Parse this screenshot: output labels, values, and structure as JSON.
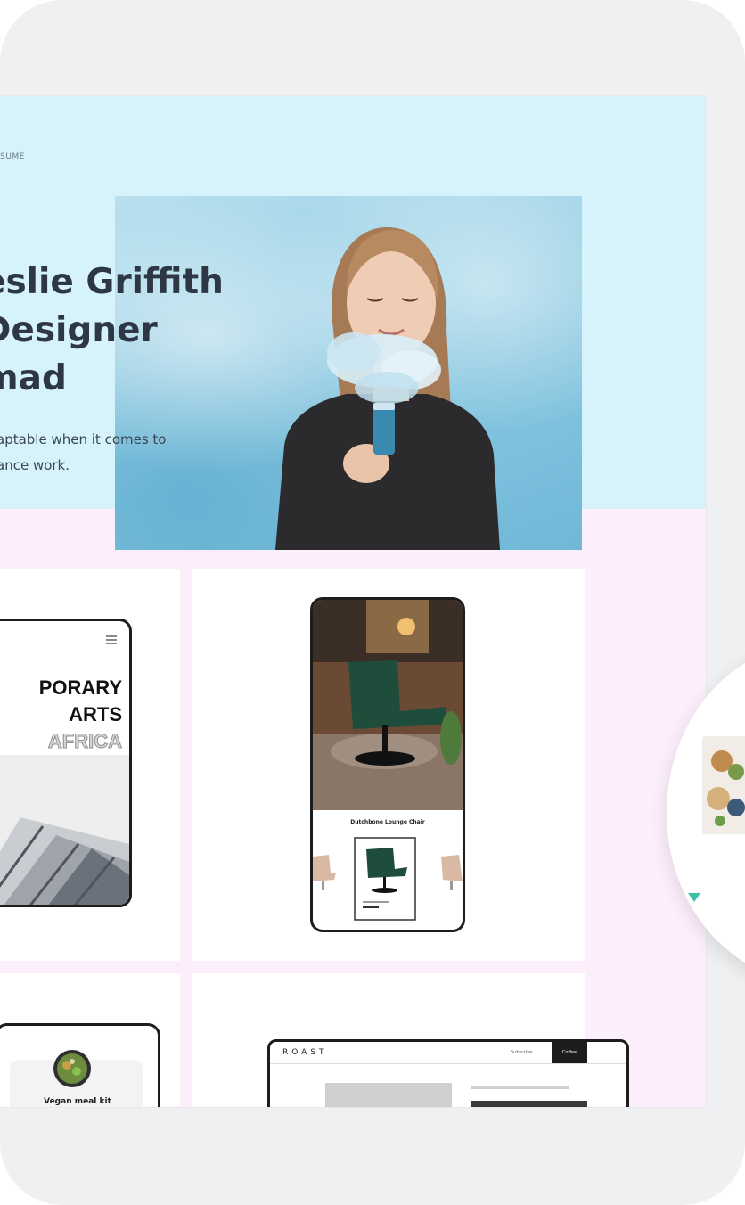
{
  "hero": {
    "resume_label": "ESUMÉ",
    "title_line1": "eslie Griffith",
    "title_line2": " Designer",
    "title_line3": "mad",
    "desc_line1": "aptable when it comes to",
    "desc_line2": "ance work."
  },
  "project_arts": {
    "line1": "PORARY",
    "line2": "ARTS",
    "line3": "AFRICA"
  },
  "project_chair": {
    "title": "Dutchbone Lounge Chair"
  },
  "project_meal": {
    "title": "Vegan meal kit"
  },
  "project_roast": {
    "logo": "ROAST",
    "subscribe": "Subscribe",
    "coffee": "Coffee"
  },
  "colors": {
    "hero_bg": "#d6f3fb",
    "page_bg": "#fceefa",
    "text_dark": "#2d3844"
  }
}
